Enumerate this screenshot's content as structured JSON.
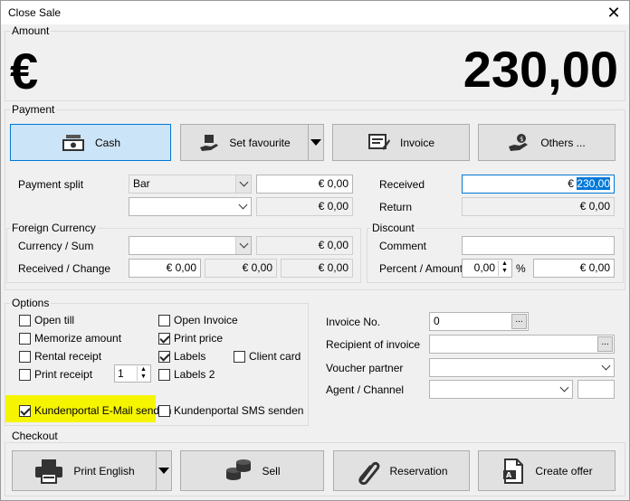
{
  "window": {
    "title": "Close Sale"
  },
  "amount": {
    "label": "Amount",
    "currency_symbol": "€",
    "value": "230,00"
  },
  "payment": {
    "label": "Payment",
    "buttons": {
      "cash": "Cash",
      "favourite": "Set favourite",
      "invoice": "Invoice",
      "others": "Others ..."
    },
    "split_label": "Payment split",
    "split_method": "Bar",
    "split_amount_1": "€ 0,00",
    "split_amount_2": "€ 0,00",
    "received_label": "Received",
    "received_prefix": "€ ",
    "received_value": "230,00",
    "return_label": "Return",
    "return_value": "€ 0,00"
  },
  "foreign_currency": {
    "label": "Foreign Currency",
    "currency_sum_label": "Currency / Sum",
    "sum_value": "€ 0,00",
    "received_change_label": "Received / Change",
    "received_value": "€ 0,00",
    "change_value_1": "€ 0,00",
    "change_value_2": "€ 0,00"
  },
  "discount": {
    "label": "Discount",
    "comment_label": "Comment",
    "percent_amount_label": "Percent / Amount",
    "percent_value": "0,00",
    "percent_sign": "%",
    "amount_value": "€ 0,00"
  },
  "options": {
    "label": "Options",
    "open_till": "Open till",
    "memorize_amount": "Memorize amount",
    "rental_receipt": "Rental receipt",
    "print_receipt": "Print receipt",
    "receipt_count": "1",
    "open_invoice": "Open Invoice",
    "print_price": "Print price",
    "labels": "Labels",
    "client_card": "Client card",
    "labels2": "Labels 2",
    "portal_email": "Kundenportal E-Mail senden",
    "portal_sms": "Kundenportal SMS senden",
    "invoice_no_label": "Invoice No.",
    "invoice_no_value": "0",
    "recipient_label": "Recipient of invoice",
    "voucher_label": "Voucher partner",
    "agent_label": "Agent / Channel",
    "dots": "..."
  },
  "checkout": {
    "label": "Checkout",
    "print": "Print English",
    "sell": "Sell",
    "reservation": "Reservation",
    "offer": "Create offer"
  },
  "colors": {
    "highlight": "#f5f500",
    "selected_button": "#cce4f7",
    "accent": "#0078d7"
  }
}
